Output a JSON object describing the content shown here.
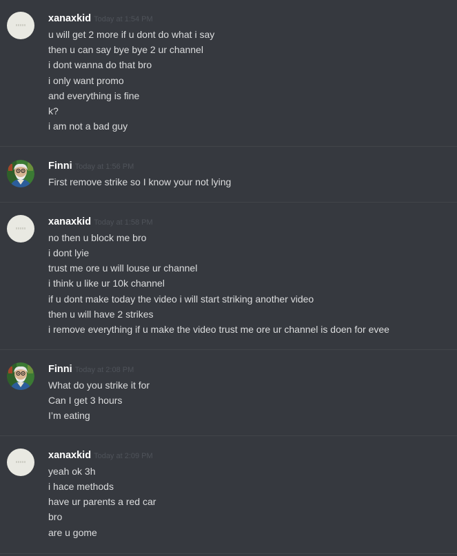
{
  "messages": [
    {
      "author": "xanaxkid",
      "timestamp": "Today at 1:54 PM",
      "avatar_icon": "default-avatar-icon",
      "lines": [
        "u will get 2 more if u dont do what i say",
        "then u can say bye bye 2 ur channel",
        "i dont wanna do that bro",
        "i only want promo",
        "and everything is fine",
        "k?",
        "i am not a bad guy"
      ]
    },
    {
      "author": "Finni",
      "timestamp": "Today at 1:56 PM",
      "avatar_icon": "finni-avatar-icon",
      "lines": [
        "First remove strike so I know your not lying"
      ]
    },
    {
      "author": "xanaxkid",
      "timestamp": "Today at 1:58 PM",
      "avatar_icon": "default-avatar-icon",
      "lines": [
        "no then u block me bro",
        "i dont lyie",
        "trust me ore u will louse ur channel",
        "i think u like ur 10k channel",
        "if u dont make today the video i will start striking another video",
        "then u will have 2 strikes",
        "i remove everything if u make the video trust me ore ur channel is doen for evee"
      ]
    },
    {
      "author": "Finni",
      "timestamp": "Today at 2:08 PM",
      "avatar_icon": "finni-avatar-icon",
      "lines": [
        "What do you strike it for",
        "Can I get 3 hours",
        "I’m eating"
      ]
    },
    {
      "author": "xanaxkid",
      "timestamp": "Today at 2:09 PM",
      "avatar_icon": "default-avatar-icon",
      "lines": [
        "yeah ok 3h",
        "i hace methods",
        "have ur parents a red car",
        "bro",
        "are u gome"
      ]
    }
  ],
  "colors": {
    "background": "#36393f",
    "author": "#ffffff",
    "timestamp": "#4f535a",
    "message_text": "#dcddde",
    "divider": "#42454a"
  }
}
